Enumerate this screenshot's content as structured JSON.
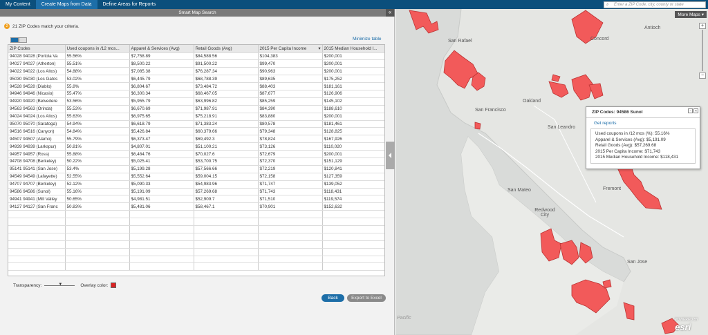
{
  "topnav": {
    "tabs": [
      {
        "label": "My Content"
      },
      {
        "label": "Create Maps from Data"
      },
      {
        "label": "Define Areas for Reports"
      }
    ],
    "search_placeholder": "Enter a ZIP Code, city, county or state"
  },
  "panel": {
    "title": "Smart Map Search",
    "criteria_count": "2",
    "criteria_text": "21 ZIP Codes match your criteria.",
    "minimize_label": "Minimize table"
  },
  "table": {
    "columns": [
      "ZIP Codes",
      "Used coupons in /12 mos...",
      "Apparel & Services (Avg)",
      "Retail Goods (Avg)",
      "2015 Per Capita Income",
      "2015 Median Household I..."
    ],
    "rows": [
      [
        "94028 94028 (Portola Va",
        "55.56%",
        "$7,758.89",
        "$84,588.56",
        "$104,383",
        "$200,001"
      ],
      [
        "94027 94027 (Atherton)",
        "55.51%",
        "$8,500.22",
        "$91,500.22",
        "$99,470",
        "$200,001"
      ],
      [
        "94022 94022 (Los Altos)",
        "54.88%",
        "$7,085.38",
        "$76,287.34",
        "$90,963",
        "$200,001"
      ],
      [
        "95030 95030 (Los Gatos",
        "53.02%",
        "$6,445.79",
        "$68,788.39",
        "$89,635",
        "$175,252"
      ],
      [
        "94528 94528 (Diablo)",
        "55.8%",
        "$6,804.67",
        "$73,484.72",
        "$88,403",
        "$181,161"
      ],
      [
        "94946 94946 (Nicasio)",
        "55.47%",
        "$6,300.34",
        "$68,467.05",
        "$87,677",
        "$126,906"
      ],
      [
        "94920 94920 (Belvedere",
        "53.56%",
        "$5,955.79",
        "$63,996.82",
        "$85,259",
        "$145,102"
      ],
      [
        "94563 94563 (Orinda)",
        "55.53%",
        "$6,670.69",
        "$71,987.91",
        "$84,390",
        "$188,610"
      ],
      [
        "94024 94024 (Los Altos)",
        "55.63%",
        "$6,975.65",
        "$75,218.91",
        "$83,880",
        "$200,001"
      ],
      [
        "95070 95070 (Saratoga)",
        "54.94%",
        "$6,618.79",
        "$71,383.24",
        "$80,578",
        "$181,461"
      ],
      [
        "94516 94516 (Canyon)",
        "54.84%",
        "$5,426.84",
        "$60,379.66",
        "$79,348",
        "$128,825"
      ],
      [
        "94507 94507 (Alamo)",
        "55.79%",
        "$6,373.47",
        "$69,492.3",
        "$78,824",
        "$167,926"
      ],
      [
        "94939 94939 (Larkspur)",
        "50.81%",
        "$4,807.01",
        "$51,100.21",
        "$73,126",
        "$110,020"
      ],
      [
        "94957 94957 (Ross)",
        "55.88%",
        "$6,484.76",
        "$70,027.6",
        "$72,679",
        "$200,001"
      ],
      [
        "94708 94708 (Berkeley)",
        "50.22%",
        "$5,025.41",
        "$53,700.75",
        "$72,370",
        "$151,129"
      ],
      [
        "95141 95141 (San Jose)",
        "53.4%",
        "$5,199.28",
        "$57,566.66",
        "$72,219",
        "$120,841"
      ],
      [
        "94549 94549 (Lafayette)",
        "52.55%",
        "$5,552.64",
        "$59,004.15",
        "$72,158",
        "$127,359"
      ],
      [
        "94707 94707 (Berkeley)",
        "52.12%",
        "$5,090.33",
        "$54,983.96",
        "$71,747",
        "$139,052"
      ],
      [
        "94586 94586 (Sunol)",
        "55.16%",
        "$5,191.09",
        "$57,269.68",
        "$71,743",
        "$118,431"
      ],
      [
        "94941 94941 (Mill Valley",
        "50.65%",
        "$4,981.51",
        "$52,909.7",
        "$71,510",
        "$119,574"
      ],
      [
        "94127 94127 (San Franc",
        "50.83%",
        "$5,481.06",
        "$58,467.1",
        "$70,901",
        "$152,632"
      ]
    ]
  },
  "controls": {
    "transparency_label": "Transparency:",
    "overlay_label": "Overlay color:",
    "back_label": "Back",
    "export_label": "Export to Excel"
  },
  "map": {
    "more_maps": "More Maps",
    "labels": [
      "San Rafael",
      "Concord",
      "Antioch",
      "Oakland",
      "San Francisco",
      "San Leandro",
      "Fremont",
      "San Mateo",
      "Redwood City",
      "San Jose",
      "Pacific"
    ],
    "fill_color": "#f25a5a",
    "popup": {
      "title": "ZIP Codes: 94586 Sunol",
      "get_reports": "Get reports",
      "lines": [
        "Used coupons in /12 mos (%):  55.16%",
        "Apparel & Services (Avg):  $5,191.09",
        "Retail Goods (Avg):  $57,269.68",
        "2015 Per Capita Income:  $71,743",
        "2015 Median Household Income:  $118,431"
      ]
    },
    "logo": "esri",
    "logo_sub": "POWERED BY"
  }
}
